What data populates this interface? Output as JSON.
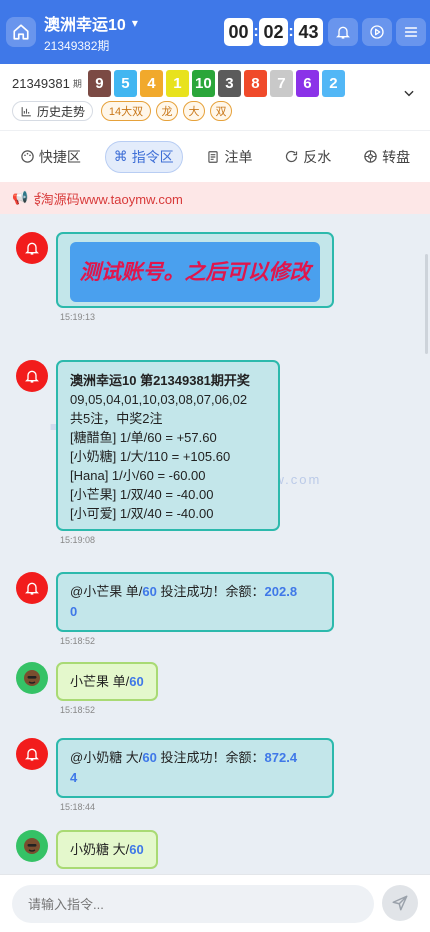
{
  "header": {
    "title": "澳洲幸运10",
    "subtitle": "21349382期",
    "timer": [
      "00",
      "02",
      "43"
    ]
  },
  "results": {
    "issue": "21349381",
    "issue_suffix": "期",
    "balls": [
      {
        "n": "9",
        "color": "#7b4a44"
      },
      {
        "n": "5",
        "color": "#41b6f1"
      },
      {
        "n": "4",
        "color": "#f1a92c"
      },
      {
        "n": "1",
        "color": "#e8e21d"
      },
      {
        "n": "10",
        "color": "#2aa63a"
      },
      {
        "n": "3",
        "color": "#5b5b5b"
      },
      {
        "n": "8",
        "color": "#f04a2a"
      },
      {
        "n": "7",
        "color": "#c9c9c9"
      },
      {
        "n": "6",
        "color": "#8b32e8"
      },
      {
        "n": "2",
        "color": "#52b7f6"
      }
    ],
    "history_label": "历史走势",
    "tags": [
      "14大双",
      "龙",
      "大",
      "双"
    ]
  },
  "tabs": [
    {
      "label": "快捷区",
      "icon": "palette-icon"
    },
    {
      "label": "指令区",
      "icon": "command-icon"
    },
    {
      "label": "注单",
      "icon": "document-icon"
    },
    {
      "label": "反水",
      "icon": "refresh-icon"
    },
    {
      "label": "转盘",
      "icon": "spin-icon"
    }
  ],
  "notice": "ई淘源码www.taoymw.com",
  "messages": {
    "m1": {
      "text": "测试账号。之后可以修改",
      "time": "15:19:13"
    },
    "m2": {
      "title": "澳洲幸运10 第21349381期开奖",
      "lines": [
        "09,05,04,01,10,03,08,07,06,02",
        "共5注，中奖2注",
        "[糖醋鱼] 1/单/60 = +57.60",
        "[小奶糖] 1/大/110 = +105.60",
        "[Hana] 1/小/60 = -60.00",
        "[小芒果] 1/双/40 = -40.00",
        "[小可爱] 1/双/40 = -40.00"
      ],
      "time": "15:19:08"
    },
    "m3": {
      "pre": "@小芒果 单/",
      "amt": "60",
      "mid": " 投注成功！余额：",
      "bal1": "202.8",
      "bal2": "0",
      "time": "15:18:52"
    },
    "m4": {
      "pre": "小芒果 单/",
      "amt": "60",
      "time": "15:18:52"
    },
    "m5": {
      "pre": "@小奶糖 大/",
      "amt": "60",
      "mid": " 投注成功！余额：",
      "bal1": "872.4",
      "bal2": "4",
      "time": "15:18:44"
    },
    "m6": {
      "pre": "小奶糖 大/",
      "amt": "60"
    }
  },
  "watermark": {
    "text": "淘源码",
    "url": "www.taoymw.com",
    "side": "taoym"
  },
  "input": {
    "placeholder": "请输入指令..."
  }
}
